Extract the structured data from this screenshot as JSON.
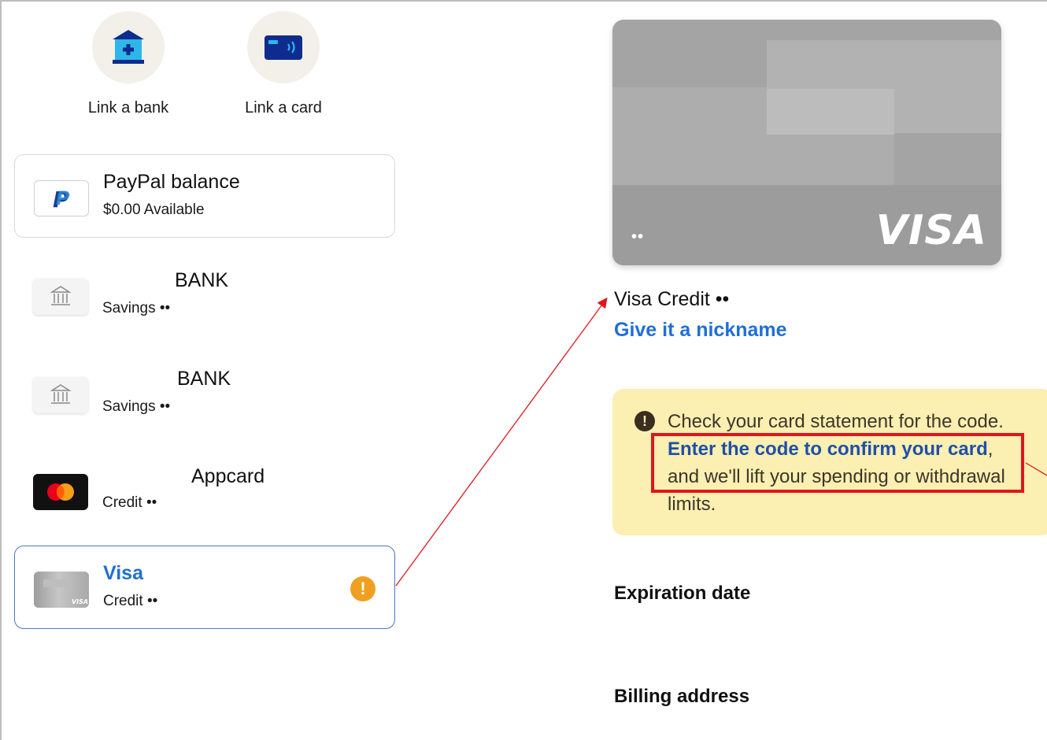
{
  "links": {
    "bank_label": "Link a bank",
    "card_label": "Link a card"
  },
  "methods": [
    {
      "title": "PayPal balance",
      "subtitle": "$0.00 Available"
    },
    {
      "title": "BANK",
      "subtitle": "Savings ••"
    },
    {
      "title": "BANK",
      "subtitle": "Savings ••"
    },
    {
      "title": "Appcard",
      "subtitle": "Credit ••"
    },
    {
      "title": "Visa",
      "subtitle": "Credit ••"
    }
  ],
  "card": {
    "brand": "VISA",
    "masked": "••",
    "name": "Visa Credit ••",
    "nickname_link": "Give it a nickname"
  },
  "notice": {
    "text_before": "Check your card statement for the code. ",
    "link_text": "Enter the code to confirm your card",
    "text_after": ", and we'll lift your spending or withdrawal limits."
  },
  "sections": {
    "expiration": "Expiration date",
    "billing": "Billing address"
  },
  "colors": {
    "accent_blue": "#1f6fd6",
    "warning_orange": "#f0a020",
    "annotation_red": "#e0151c",
    "notice_bg": "#fbefb1"
  },
  "icons": [
    "bank-add-icon",
    "card-contactless-icon",
    "paypal-logo-icon",
    "bank-building-icon",
    "mastercard-logo-icon",
    "visa-card-thumb-icon",
    "warning-icon",
    "info-icon"
  ]
}
